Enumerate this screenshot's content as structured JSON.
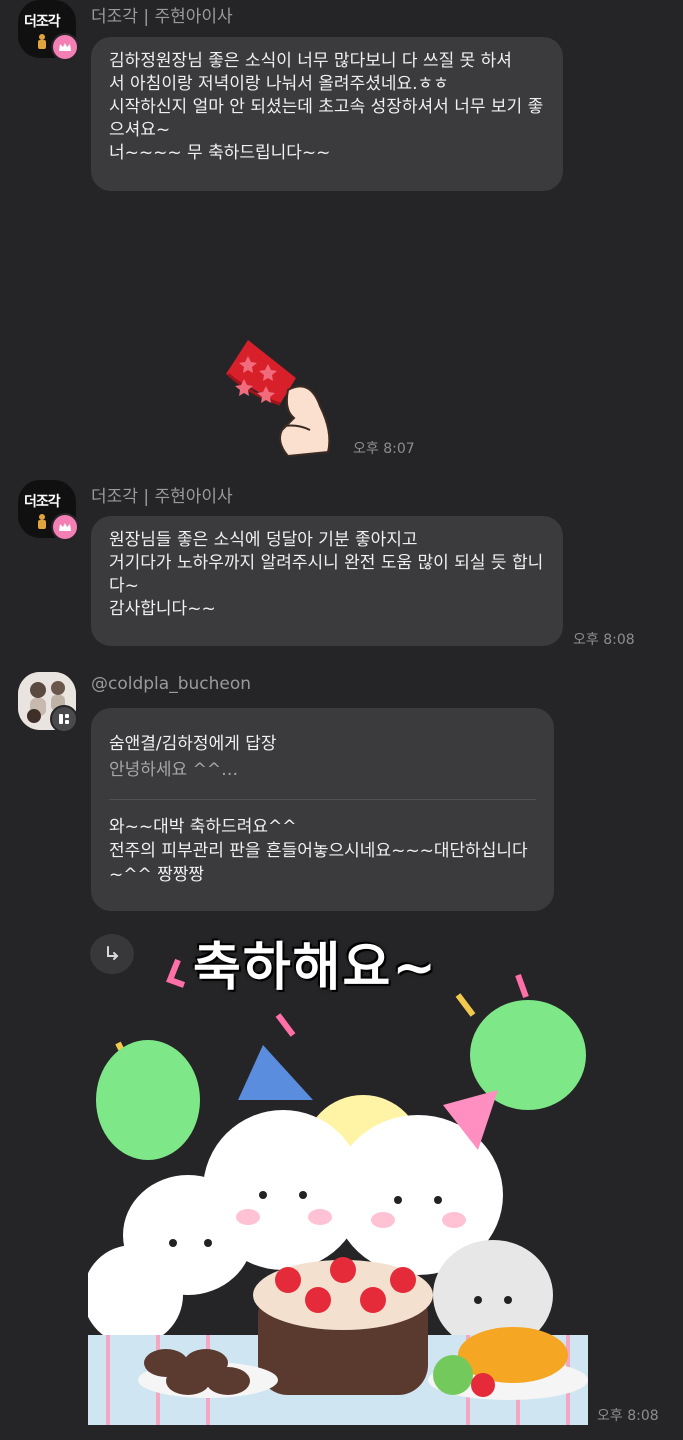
{
  "messages": [
    {
      "sender": "더조각 | 주현아이사",
      "avatar_text": "더조각",
      "text": "김하정원장님 좋은 소식이 너무 많다보니 다 쓰질 못 하셔\n서 아침이랑 저녁이랑 나눠서 올려주셨네요.ㅎㅎ\n시작하신지 얼마 안 되셨는데 초고속 성장하셔서 너무 보기 좋으셔요~\n너~~~~ 무 축하드립니다~~"
    },
    {
      "type": "sticker",
      "sticker_name": "party-popper",
      "time": "오후 8:07"
    },
    {
      "sender": "더조각 | 주현아이사",
      "avatar_text": "더조각",
      "text": "원장님들 좋은 소식에 덩달아 기분 좋아지고\n거기다가 노하우까지 알려주시니 완전 도움 많이 되실 듯 합니다~\n감사합니다~~",
      "time": "오후 8:08"
    },
    {
      "sender": "@coldpla_bucheon",
      "reply_to": "숨앤결/김하정에게 답장",
      "reply_preview": "안녕하세요 ^^…",
      "text": "와~~대박 축하드려요^^\n전주의 피부관리 판을 흔들어놓으시네요~~~대단하십니다~^^ 짱짱짱"
    },
    {
      "type": "sticker",
      "sticker_caption": "축하해요~",
      "sticker_name": "celebration-cats-cake",
      "time": "오후 8:08"
    }
  ],
  "colors": {
    "background": "#252527",
    "bubble": "#3b3b3e",
    "badge_pink": "#f47fb5"
  }
}
